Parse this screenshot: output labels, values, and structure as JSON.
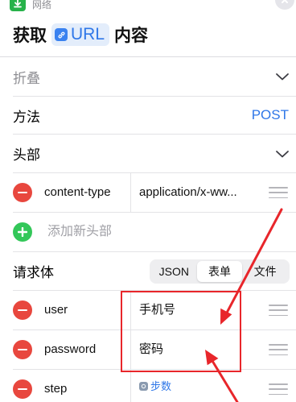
{
  "header": {
    "category_label": "网络",
    "title_prefix": "获取",
    "token_label": "URL",
    "title_suffix": "内容"
  },
  "fields": {
    "collapse_label": "折叠",
    "method_label": "方法",
    "method_value": "POST",
    "headers_label": "头部",
    "add_header_label": "添加新头部",
    "body_label": "请求体"
  },
  "headers": [
    {
      "key": "content-type",
      "value": "application/x-ww..."
    }
  ],
  "body_types": [
    {
      "label": "JSON",
      "selected": false
    },
    {
      "label": "表单",
      "selected": true
    },
    {
      "label": "文件",
      "selected": false
    }
  ],
  "body_params": [
    {
      "key": "user",
      "value": "手机号"
    },
    {
      "key": "password",
      "value": "密码"
    },
    {
      "key": "step",
      "value": "步数",
      "is_variable": true
    }
  ],
  "colors": {
    "accent": "#2f77e8",
    "remove": "#e8473e",
    "add": "#33c759",
    "annotation": "#e8262b"
  }
}
